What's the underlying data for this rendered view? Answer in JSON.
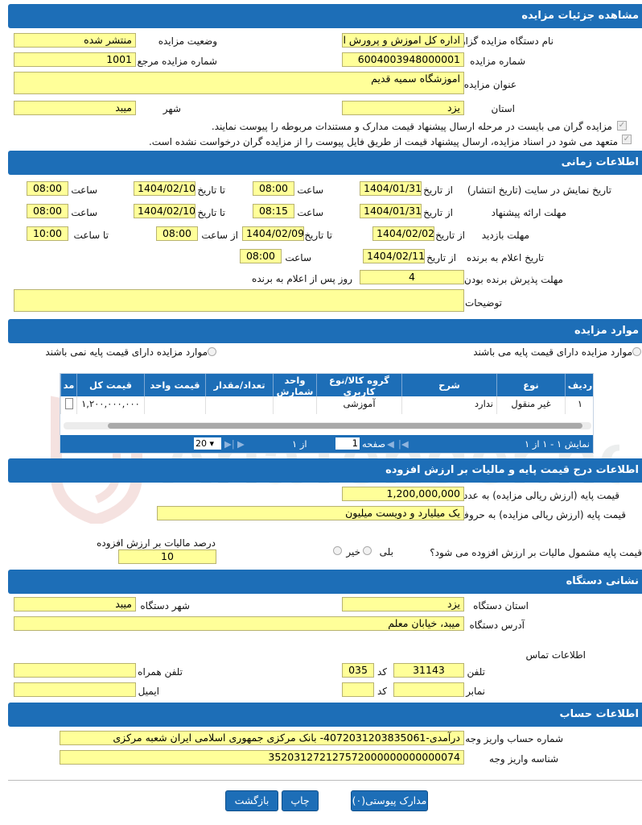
{
  "sections": {
    "details": "مشاهده جزئیات مزایده",
    "timing": "اطلاعات زمانی",
    "items": "موارد مزایده",
    "price": "اطلاعات درج قیمت پایه و مالیات بر ارزش افزوده",
    "org": "نشانی دستگاه",
    "account": "اطلاعات حساب"
  },
  "details": {
    "org_name_label": "نام دستگاه مزایده گزار",
    "org_name": "اداره کل اموزش و پرورش اس",
    "status_label": "وضعیت مزایده",
    "status": "منتشر شده",
    "number_label": "شماره مزایده",
    "number": "6004003948000001",
    "ref_label": "شماره مزایده مرجع",
    "ref": "1001",
    "title_label": "عنوان مزایده",
    "title": "اموزشگاه سمیه قدیم",
    "province_label": "استان",
    "province": "یزد",
    "city_label": "شهر",
    "city": "میبد",
    "check1": "مزایده گران می بایست در مرحله ارسال پیشنهاد قیمت مدارک و مستندات مربوطه را پیوست نمایند.",
    "check2": "متعهد می شود در اسناد مزایده، ارسال پیشنهاد قیمت از طریق فایل پیوست را از مزایده گران درخواست نشده است."
  },
  "timing": {
    "display_label": "تاریخ نمایش در سایت (تاریخ انتشار)",
    "offer_label": "مهلت ارائه پیشنهاد",
    "visit_label": "مهلت بازدید",
    "announce_label": "تاریخ اعلام به برنده",
    "accept_label": "مهلت پذیرش برنده بودن",
    "from_date": "از تاریخ",
    "to_date": "تا تاریخ",
    "time": "ساعت",
    "from_time": "از ساعت",
    "to_time": "تا ساعت",
    "display_from": "1404/01/31",
    "display_from_time": "08:00",
    "display_to": "1404/02/10",
    "display_to_time": "08:00",
    "offer_from": "1404/01/31",
    "offer_from_time": "08:15",
    "offer_to": "1404/02/10",
    "offer_to_time": "08:00",
    "visit_from": "1404/02/02",
    "visit_to": "1404/02/09",
    "visit_from_time": "08:00",
    "visit_to_time": "10:00",
    "announce_from": "1404/02/11",
    "announce_time": "08:00",
    "accept_days": "4",
    "accept_suffix": "روز پس از اعلام به برنده",
    "notes_label": "توضیحات",
    "notes": ""
  },
  "items": {
    "with_base": "موارد مزایده دارای قیمت پایه می باشند",
    "without_base": "موارد مزایده دارای قیمت پایه نمی باشند",
    "headers": {
      "row": "ردیف",
      "type": "نوع",
      "desc": "شرح",
      "group": "گروه کالا/نوع کاربری",
      "unit": "واحد شمارش",
      "qty": "تعداد/مقدار",
      "unit_price": "قیمت واحد",
      "total": "قیمت کل",
      "extra": "مد"
    },
    "row": {
      "row": "۱",
      "type": "غیر منقول",
      "type2": "ندارد",
      "group": "آموزشی",
      "unit": "",
      "qty": "",
      "unit_price": "",
      "total": "۱,۲۰۰,۰۰۰,۰۰۰"
    },
    "pager": {
      "summary": "نمایش ۱ - ۱ از ۱",
      "page_label": "صفحه",
      "page_value": "1",
      "of_label": "از ۱",
      "page_size": "20"
    }
  },
  "price": {
    "base_num_label": "قیمت پایه (ارزش ریالی مزایده) به عدد",
    "base_num": "1,200,000,000",
    "base_words_label": "قیمت پایه (ارزش ریالی مزایده) به حروف",
    "base_words": "یک میلیارد و دویست میلیون",
    "vat_q": "قیمت پایه مشمول مالیات بر ارزش افزوده می شود؟",
    "yes": "بلی",
    "no": "خیر",
    "vat_pct_label": "درصد مالیات بر ارزش افزوده",
    "vat_pct": "10"
  },
  "org": {
    "province_label": "استان دستگاه",
    "province": "یزد",
    "city_label": "شهر دستگاه",
    "city": "میبد",
    "address_label": "آدرس دستگاه",
    "address": "میبد، خیابان معلم",
    "contact_label": "اطلاعات تماس",
    "phone_label": "تلفن",
    "phone": "31143",
    "code_label": "کد",
    "phone_code": "035",
    "mobile_label": "تلفن همراه",
    "mobile": "",
    "fax_label": "نمابر",
    "fax": "",
    "fax_code": "",
    "email_label": "ایمیل",
    "email": ""
  },
  "account": {
    "account_label": "شماره حساب واریز وجه",
    "account": "درآمدی-4072031203835061- بانک مرکزی جمهوری اسلامی ایران شعبه مرکزی",
    "shaba_label": "شناسه واریز وجه",
    "shaba": "352031272127572000000000000074"
  },
  "buttons": {
    "attachments": "مدارک پیوستی(۰)",
    "print": "چاپ",
    "back": "بازگشت"
  },
  "colors": {
    "header_blue": "#1d6eb7",
    "field_yellow": "#ffff99"
  }
}
